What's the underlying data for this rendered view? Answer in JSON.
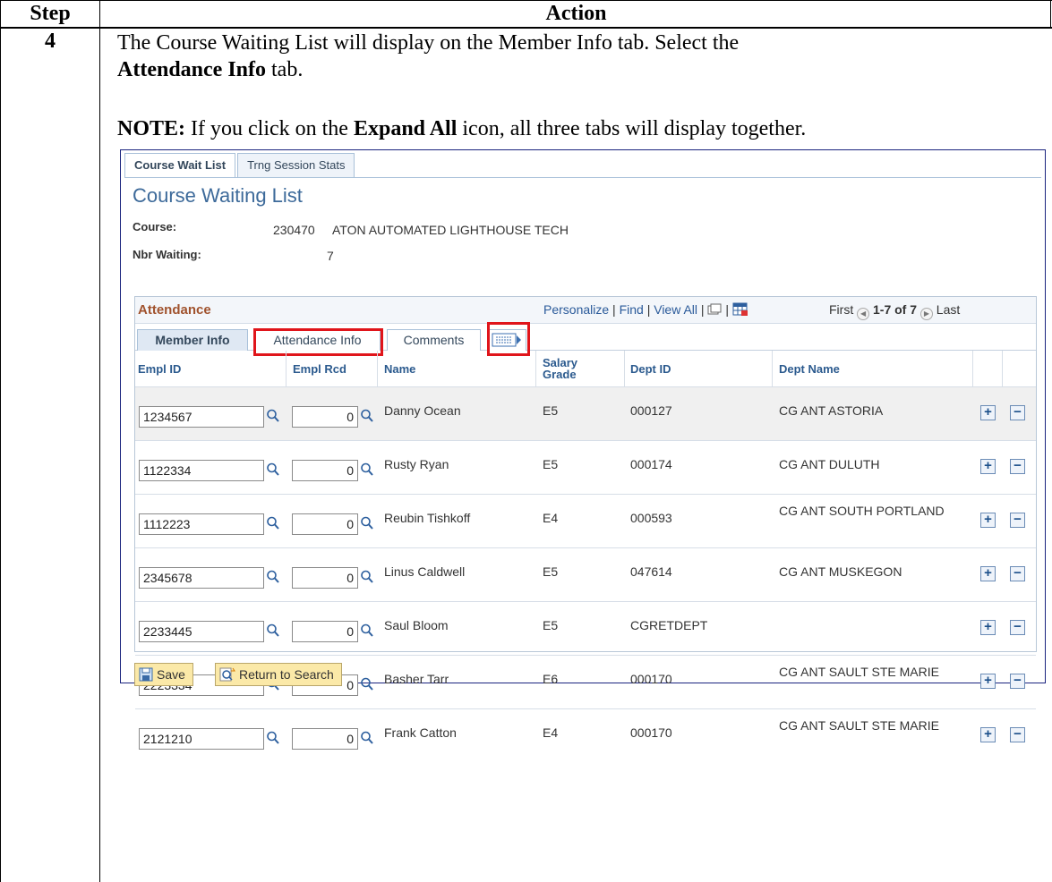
{
  "doc": {
    "header_step": "Step",
    "header_action": "Action",
    "step_number": "4",
    "instruction_1": "The Course Waiting List will display on the Member Info tab. Select the",
    "instruction_bold": "Attendance Info",
    "instruction_2": " tab.",
    "note_label": "NOTE:",
    "note_text_1": " If you click on the ",
    "note_bold": "Expand All",
    "note_text_2": " icon, all three tabs will display together."
  },
  "page_tabs": [
    {
      "label": "Course Wait List",
      "active": true
    },
    {
      "label": "Trng Session Stats",
      "active": false
    }
  ],
  "page_title": "Course Waiting List",
  "course": {
    "label": "Course:",
    "number": "230470",
    "name": "ATON AUTOMATED LIGHTHOUSE TECH"
  },
  "waiting": {
    "label": "Nbr Waiting:",
    "value": "7"
  },
  "grid": {
    "title": "Attendance",
    "nav": {
      "personalize": "Personalize",
      "find": "Find",
      "view_all": "View All"
    },
    "pager": {
      "first": "First",
      "range": "1-7 of 7",
      "last": "Last"
    },
    "tabs": [
      "Member Info",
      "Attendance Info",
      "Comments"
    ],
    "columns": [
      "Empl ID",
      "Empl Rcd",
      "Name",
      "Salary Grade",
      "Dept ID",
      "Dept Name"
    ],
    "rows": [
      {
        "empl_id": "1234567",
        "empl_rcd": "0",
        "name": "Danny Ocean",
        "grade": "E5",
        "dept_id": "000127",
        "dept_name": "CG ANT ASTORIA"
      },
      {
        "empl_id": "1122334",
        "empl_rcd": "0",
        "name": "Rusty Ryan",
        "grade": "E5",
        "dept_id": "000174",
        "dept_name": "CG ANT DULUTH"
      },
      {
        "empl_id": "1112223",
        "empl_rcd": "0",
        "name": "Reubin Tishkoff",
        "grade": "E4",
        "dept_id": "000593",
        "dept_name": "CG ANT SOUTH PORTLAND"
      },
      {
        "empl_id": "2345678",
        "empl_rcd": "0",
        "name": "Linus Caldwell",
        "grade": "E5",
        "dept_id": "047614",
        "dept_name": "CG ANT MUSKEGON"
      },
      {
        "empl_id": "2233445",
        "empl_rcd": "0",
        "name": "Saul Bloom",
        "grade": "E5",
        "dept_id": "CGRETDEPT",
        "dept_name": ""
      },
      {
        "empl_id": "2223334",
        "empl_rcd": "0",
        "name": "Basher Tarr",
        "grade": "E6",
        "dept_id": "000170",
        "dept_name": "CG ANT SAULT STE MARIE"
      },
      {
        "empl_id": "2121210",
        "empl_rcd": "0",
        "name": "Frank Catton",
        "grade": "E4",
        "dept_id": "000170",
        "dept_name": "CG ANT SAULT STE MARIE"
      }
    ]
  },
  "buttons": {
    "save": "Save",
    "return": "Return to Search"
  },
  "colors": {
    "highlight": "#e0151b",
    "title_blue": "#3d6a9a",
    "grid_title": "#a0522d",
    "button_bg": "#fbe9a8"
  }
}
